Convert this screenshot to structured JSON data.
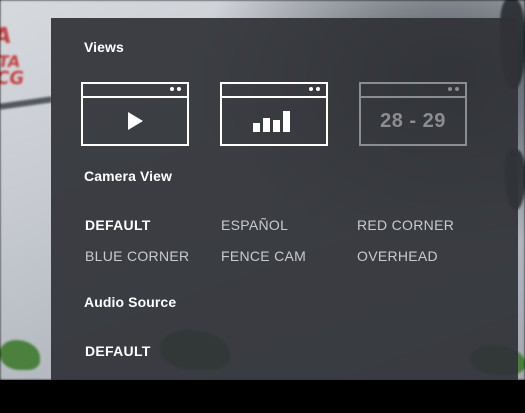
{
  "views": {
    "title": "Views",
    "tiles": [
      {
        "icon": "play-icon",
        "label": "",
        "enabled": true
      },
      {
        "icon": "bar-chart-icon",
        "label": "",
        "enabled": true
      },
      {
        "icon": "",
        "label": "28 - 29",
        "enabled": false
      }
    ]
  },
  "camera_view": {
    "title": "Camera View",
    "selected": "DEFAULT",
    "options": [
      "DEFAULT",
      "ESPAÑOL",
      "RED CORNER",
      "BLUE CORNER",
      "FENCE CAM",
      "OVERHEAD"
    ]
  },
  "audio_source": {
    "title": "Audio Source",
    "selected": "DEFAULT",
    "options": [
      "DEFAULT"
    ]
  },
  "colors": {
    "panel_bg": "#303338",
    "text": "#ffffff",
    "option_text": "#c9cbce",
    "disabled": "#8a8d92"
  }
}
